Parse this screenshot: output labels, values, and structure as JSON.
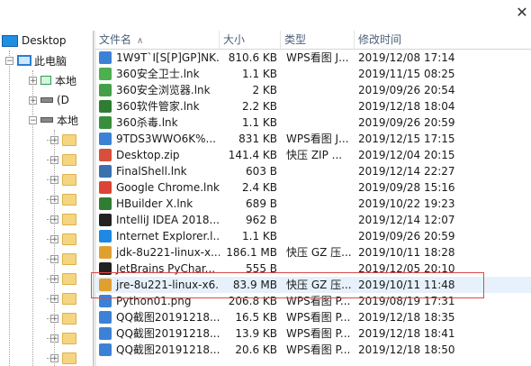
{
  "tree": {
    "desktop": "Desktop",
    "this_pc": "此电脑",
    "items": [
      {
        "label": "本地",
        "icon": "network-drive-icon"
      },
      {
        "label": "(D",
        "icon": "drive-icon"
      },
      {
        "label": "本地",
        "icon": "drive-icon"
      }
    ],
    "folder_count": 12
  },
  "columns": {
    "name": "文件名",
    "size": "大小",
    "type": "类型",
    "date": "修改时间"
  },
  "files": [
    {
      "name": "1W9T`I[S[P]GP]NK...",
      "size": "810.6 KB",
      "type": "WPS看图 J...",
      "date": "2019/12/08 17:14",
      "icon": "image-icon",
      "color": "#3b82d6"
    },
    {
      "name": "360安全卫士.lnk",
      "size": "1.1 KB",
      "type": "",
      "date": "2019/11/15 08:25",
      "icon": "shortcut-360-icon",
      "color": "#4caf50"
    },
    {
      "name": "360安全浏览器.lnk",
      "size": "2 KB",
      "type": "",
      "date": "2019/09/26 20:54",
      "icon": "shortcut-360-browser-icon",
      "color": "#43a047"
    },
    {
      "name": "360软件管家.lnk",
      "size": "2.2 KB",
      "type": "",
      "date": "2019/12/18 18:04",
      "icon": "shortcut-360-manager-icon",
      "color": "#2e7d32"
    },
    {
      "name": "360杀毒.lnk",
      "size": "1.1 KB",
      "type": "",
      "date": "2019/09/26 20:59",
      "icon": "shortcut-360-antivirus-icon",
      "color": "#388e3c"
    },
    {
      "name": "9TDS3WWO6K%...",
      "size": "831 KB",
      "type": "WPS看图 J...",
      "date": "2019/12/15 17:15",
      "icon": "image-icon",
      "color": "#3b82d6"
    },
    {
      "name": "Desktop.zip",
      "size": "141.4 KB",
      "type": "快压 ZIP ...",
      "date": "2019/12/04 20:15",
      "icon": "zip-archive-icon",
      "color": "#d94f3d"
    },
    {
      "name": "FinalShell.lnk",
      "size": "603 B",
      "type": "",
      "date": "2019/12/14 22:27",
      "icon": "shortcut-finalshell-icon",
      "color": "#3a6fb0"
    },
    {
      "name": "Google Chrome.lnk",
      "size": "2.4 KB",
      "type": "",
      "date": "2019/09/28 15:16",
      "icon": "shortcut-chrome-icon",
      "color": "#db4437"
    },
    {
      "name": "HBuilder X.lnk",
      "size": "689 B",
      "type": "",
      "date": "2019/10/22 19:23",
      "icon": "shortcut-hbuilder-icon",
      "color": "#2e7d32"
    },
    {
      "name": "IntelliJ IDEA 2018...",
      "size": "962 B",
      "type": "",
      "date": "2019/12/14 12:07",
      "icon": "shortcut-intellij-icon",
      "color": "#222222"
    },
    {
      "name": "Internet Explorer.l...",
      "size": "1.1 KB",
      "type": "",
      "date": "2019/09/26 20:59",
      "icon": "shortcut-ie-icon",
      "color": "#1e88e5"
    },
    {
      "name": "jdk-8u221-linux-x...",
      "size": "186.1 MB",
      "type": "快压 GZ 压...",
      "date": "2019/10/11 18:28",
      "icon": "gz-archive-icon",
      "color": "#e0a030"
    },
    {
      "name": "JetBrains PyChar...",
      "size": "555 B",
      "type": "",
      "date": "2019/12/05 20:10",
      "icon": "shortcut-pycharm-icon",
      "color": "#222222"
    },
    {
      "name": "jre-8u221-linux-x6...",
      "size": "83.9 MB",
      "type": "快压 GZ 压...",
      "date": "2019/10/11 11:48",
      "icon": "gz-archive-icon",
      "color": "#e0a030",
      "selected": true
    },
    {
      "name": "Python01.png",
      "size": "206.8 KB",
      "type": "WPS看图 P...",
      "date": "2019/08/19 17:31",
      "icon": "image-icon",
      "color": "#3b82d6"
    },
    {
      "name": "QQ截图20191218...",
      "size": "16.5 KB",
      "type": "WPS看图 P...",
      "date": "2019/12/18 18:35",
      "icon": "image-icon",
      "color": "#3b82d6"
    },
    {
      "name": "QQ截图20191218...",
      "size": "13.9 KB",
      "type": "WPS看图 P...",
      "date": "2019/12/18 18:41",
      "icon": "image-icon",
      "color": "#3b82d6"
    },
    {
      "name": "QQ截图20191218...",
      "size": "20.6 KB",
      "type": "WPS看图 P...",
      "date": "2019/12/18 18:50",
      "icon": "image-icon",
      "color": "#3b82d6"
    }
  ]
}
